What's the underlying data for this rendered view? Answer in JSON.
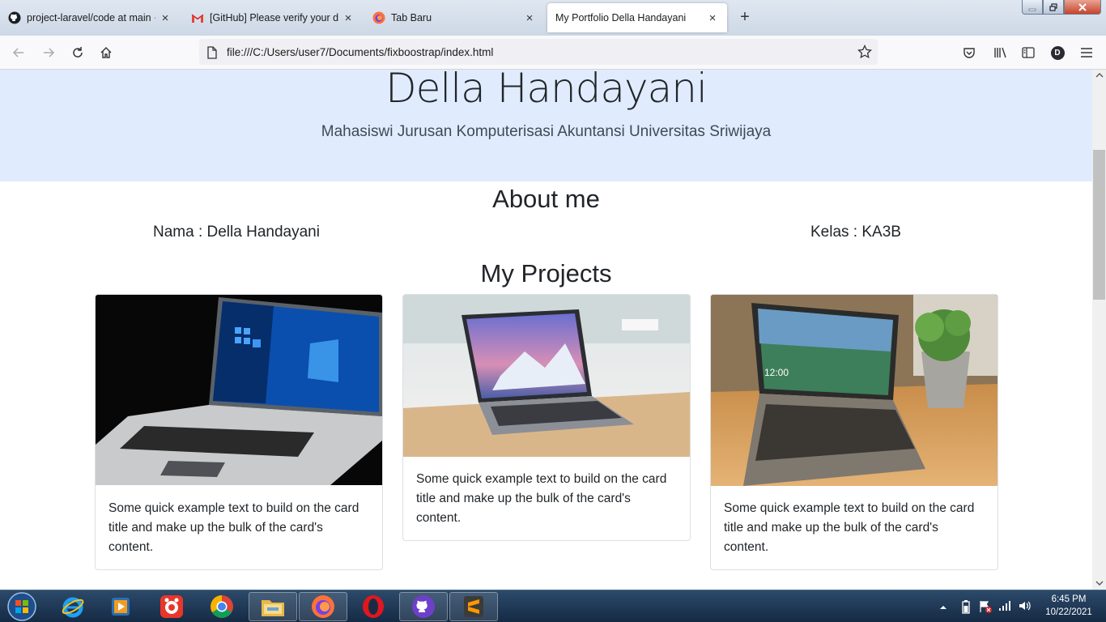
{
  "browser": {
    "tabs": [
      {
        "title": "project-laravel/code at main · d",
        "icon": "github-icon"
      },
      {
        "title": "[GitHub] Please verify your devi",
        "icon": "gmail-icon"
      },
      {
        "title": "Tab Baru",
        "icon": "firefox-icon"
      },
      {
        "title": "My Portfolio Della Handayani",
        "icon": "none",
        "active": true
      }
    ],
    "new_tab": "+",
    "tab_close": "×",
    "url": "file:///C:/Users/user7/Documents/fixboostrap/index.html",
    "profile_initial": "D",
    "window_controls": [
      "minimize",
      "maximize",
      "close"
    ]
  },
  "page": {
    "hero": {
      "name": "Della Handayani",
      "subtitle": "Mahasiswi Jurusan Komputerisasi Akuntansi Universitas Sriwijaya"
    },
    "about": {
      "heading": "About me",
      "name_line": "Nama : Della Handayani",
      "class_line": "Kelas : KA3B"
    },
    "projects": {
      "heading": "My Projects",
      "cards": [
        {
          "image": "laptop-windows-black-background",
          "text": "Some quick example text to build on the card title and make up the bulk of the card's content."
        },
        {
          "image": "macbook-on-table",
          "text": "Some quick example text to build on the card title and make up the bulk of the card's content."
        },
        {
          "image": "laptop-with-plant",
          "text": "Some quick example text to build on the card title and make up the bulk of the card's content."
        }
      ]
    }
  },
  "taskbar": {
    "apps": [
      "start-orb",
      "internet-explorer",
      "media-player",
      "record-app",
      "chrome",
      "file-explorer",
      "firefox",
      "opera",
      "github-desktop",
      "sublime-text"
    ],
    "time": "6:45 PM",
    "date": "10/22/2021"
  }
}
